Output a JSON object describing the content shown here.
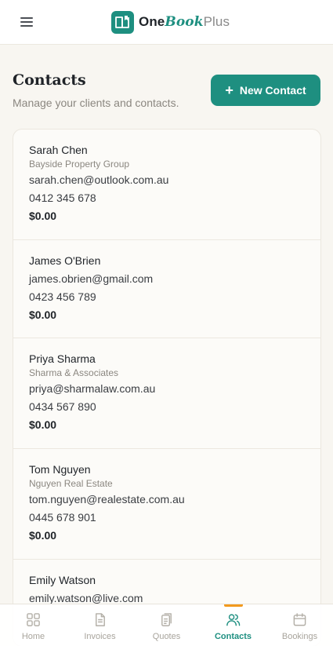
{
  "app": {
    "brand_one": "One",
    "brand_book": "Book",
    "brand_plus": "Plus",
    "accent": "#1e8f80",
    "highlight": "#f29a1e"
  },
  "page": {
    "title": "Contacts",
    "subtitle": "Manage your clients and contacts.",
    "new_button": "New Contact"
  },
  "contacts": [
    {
      "name": "Sarah Chen",
      "company": "Bayside Property Group",
      "email": "sarah.chen@outlook.com.au",
      "phone": "0412 345 678",
      "amount": "$0.00"
    },
    {
      "name": "James O'Brien",
      "company": "",
      "email": "james.obrien@gmail.com",
      "phone": "0423 456 789",
      "amount": "$0.00"
    },
    {
      "name": "Priya Sharma",
      "company": "Sharma & Associates",
      "email": "priya@sharmalaw.com.au",
      "phone": "0434 567 890",
      "amount": "$0.00"
    },
    {
      "name": "Tom Nguyen",
      "company": "Nguyen Real Estate",
      "email": "tom.nguyen@realestate.com.au",
      "phone": "0445 678 901",
      "amount": "$0.00"
    },
    {
      "name": "Emily Watson",
      "company": "",
      "email": "emily.watson@live.com",
      "phone": "",
      "amount": ""
    }
  ],
  "nav": [
    {
      "label": "Home",
      "icon": "grid-icon",
      "active": false
    },
    {
      "label": "Invoices",
      "icon": "document-icon",
      "active": false
    },
    {
      "label": "Quotes",
      "icon": "clipboard-icon",
      "active": false
    },
    {
      "label": "Contacts",
      "icon": "users-icon",
      "active": true
    },
    {
      "label": "Bookings",
      "icon": "calendar-icon",
      "active": false
    }
  ]
}
